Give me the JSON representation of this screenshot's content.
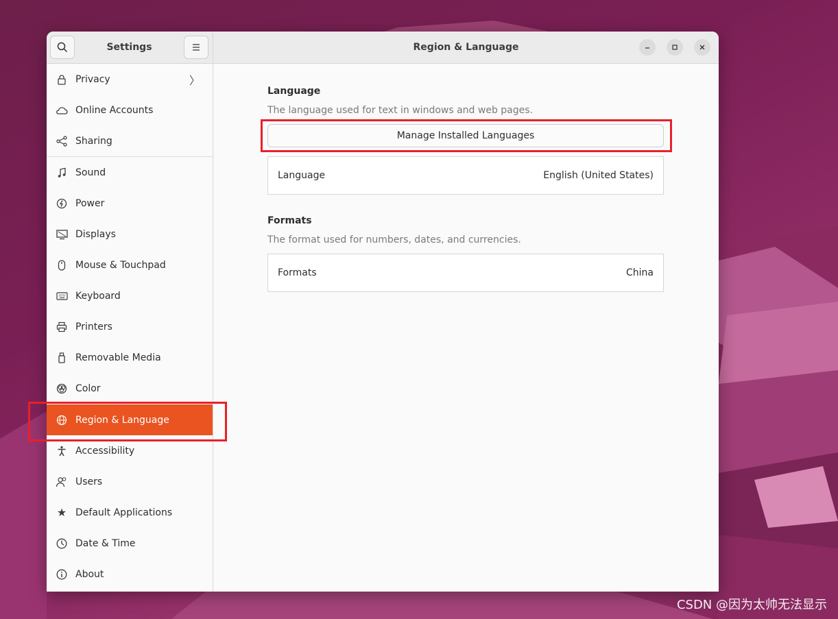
{
  "sidebar": {
    "title": "Settings",
    "search_icon": "search-icon",
    "menu_icon": "hamburger-menu-icon",
    "items": [
      {
        "label": "Privacy",
        "icon": "lock-icon"
      },
      {
        "label": "Online Accounts",
        "icon": "cloud-icon"
      },
      {
        "label": "Sharing",
        "icon": "share-icon"
      },
      {
        "label": "Sound",
        "icon": "music-note-icon"
      },
      {
        "label": "Power",
        "icon": "power-icon"
      },
      {
        "label": "Displays",
        "icon": "display-icon"
      },
      {
        "label": "Mouse & Touchpad",
        "icon": "mouse-icon"
      },
      {
        "label": "Keyboard",
        "icon": "keyboard-icon"
      },
      {
        "label": "Printers",
        "icon": "printer-icon"
      },
      {
        "label": "Removable Media",
        "icon": "usb-drive-icon"
      },
      {
        "label": "Color",
        "icon": "color-icon"
      },
      {
        "label": "Region & Language",
        "icon": "globe-icon",
        "active": true
      },
      {
        "label": "Accessibility",
        "icon": "accessibility-icon"
      },
      {
        "label": "Users",
        "icon": "users-icon"
      },
      {
        "label": "Default Applications",
        "icon": "star-icon"
      },
      {
        "label": "Date & Time",
        "icon": "clock-icon"
      },
      {
        "label": "About",
        "icon": "info-icon"
      }
    ]
  },
  "header": {
    "title": "Region & Language"
  },
  "language_section": {
    "title": "Language",
    "description": "The language used for text in windows and web pages.",
    "manage_button": "Manage Installed Languages",
    "row_label": "Language",
    "row_value": "English (United States)"
  },
  "formats_section": {
    "title": "Formats",
    "description": "The format used for numbers, dates, and currencies.",
    "row_label": "Formats",
    "row_value": "China"
  },
  "watermark": "CSDN @因为太帅无法显示",
  "colors": {
    "accent": "#e95420",
    "highlight_box": "#e8202a"
  }
}
